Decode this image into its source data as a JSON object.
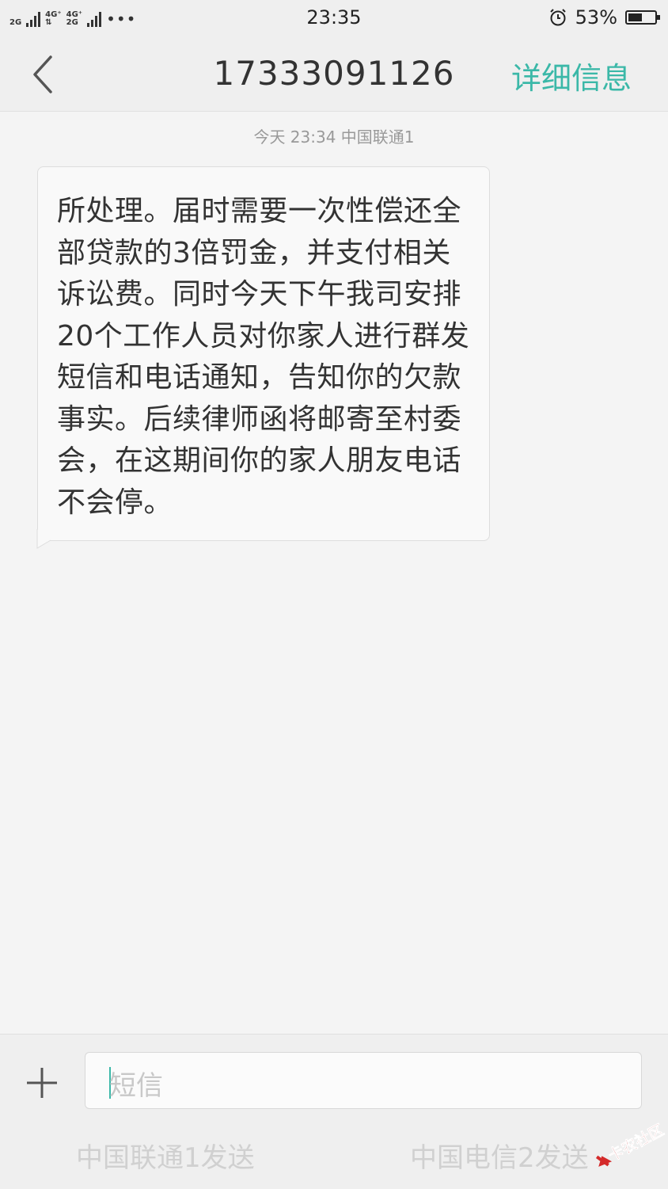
{
  "status_bar": {
    "net1": "2G",
    "net2_top": "4G⁺",
    "net3_top": "4G⁺",
    "net3_bottom": "2G",
    "more": "•••",
    "time": "23:35",
    "battery": "53%",
    "battery_level": 0.53,
    "icons": [
      "signal-icon",
      "alarm-icon",
      "battery-icon"
    ]
  },
  "header": {
    "title": "17333091126",
    "details": "详细信息",
    "accent_color": "#3bb8a8"
  },
  "messages": [
    {
      "timestamp": "今天  23:34  中国联通1",
      "text": "所处理。届时需要一次性偿还全部贷款的3倍罚金，并支付相关诉讼费。同时今天下午我司安排20个工作人员对你家人进行群发短信和电话通知，告知你的欠款事实。后续律师函将邮寄至村委会，在这期间你的家人朋友电话不会停。"
    }
  ],
  "composer": {
    "placeholder": "短信",
    "send_sim1": "中国联通1发送",
    "send_sim2": "中国电信2发送"
  },
  "watermark": {
    "text": "卡农社区"
  }
}
